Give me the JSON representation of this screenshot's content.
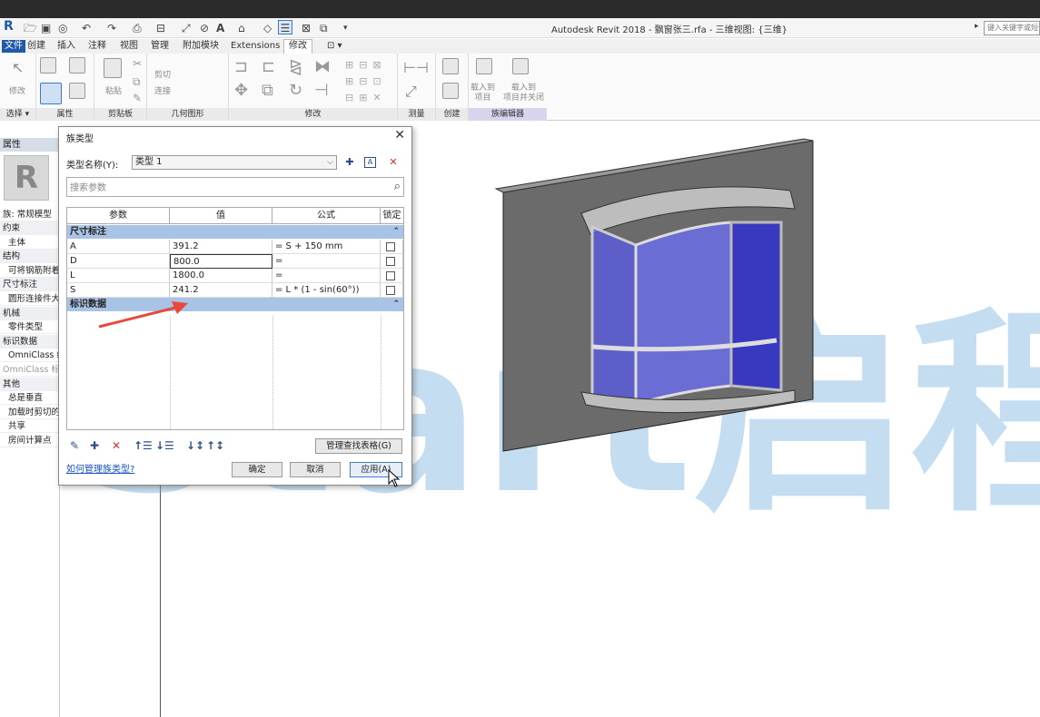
{
  "app": {
    "title": "Autodesk Revit 2018 -    飘窗张三.rfa - 三维视图: {三维}",
    "search_placeholder": "键入关键字或短语"
  },
  "tabs": [
    "文件",
    "创建",
    "插入",
    "注释",
    "视图",
    "管理",
    "附加模块",
    "Extensions",
    "修改",
    "⊡ ▾"
  ],
  "active_tab_index": 8,
  "ribbon": {
    "groups": [
      "选择 ▾",
      "属性",
      "剪贴板",
      "几何图形",
      "修改",
      "测量",
      "创建",
      "族编辑器"
    ],
    "labels": {
      "modify": "修改",
      "paste": "粘贴",
      "cut": "剪切",
      "join": "连接",
      "load_project": "载入到\n项目",
      "load_close": "载入到\n项目并关闭"
    }
  },
  "properties_panel": {
    "title": "属性",
    "family": "族: 常规模型",
    "rows": [
      {
        "text": "约束",
        "kind": "hdr"
      },
      {
        "text": "主体",
        "kind": "sub"
      },
      {
        "text": "结构",
        "kind": "hdr"
      },
      {
        "text": "可将钢筋附着",
        "kind": "sub"
      },
      {
        "text": "尺寸标注",
        "kind": "hdr"
      },
      {
        "text": "圆形连接件大",
        "kind": "sub"
      },
      {
        "text": "机械",
        "kind": "hdr"
      },
      {
        "text": "零件类型",
        "kind": "sub"
      },
      {
        "text": "标识数据",
        "kind": "hdr"
      },
      {
        "text": "OmniClass 编",
        "kind": "sub"
      },
      {
        "text": "OmniClass 标",
        "kind": "grey"
      },
      {
        "text": "其他",
        "kind": "hdr"
      },
      {
        "text": "总是垂直",
        "kind": "sub"
      },
      {
        "text": "加载时剪切的",
        "kind": "sub"
      },
      {
        "text": "共享",
        "kind": "sub"
      },
      {
        "text": "房间计算点",
        "kind": "sub"
      }
    ]
  },
  "dialog": {
    "title": "族类型",
    "close": "✕",
    "type_name_label": "类型名称(Y):",
    "type_name_value": "类型 1",
    "search_placeholder": "搜索参数",
    "columns": [
      "参数",
      "值",
      "公式",
      "锁定"
    ],
    "sections": [
      {
        "name": "尺寸标注",
        "rows": [
          {
            "param": "A",
            "value": "391.2",
            "formula": "= S + 150 mm",
            "locked": false
          },
          {
            "param": "D",
            "value": "800.0",
            "formula": "=",
            "locked": false
          },
          {
            "param": "L",
            "value": "1800.0",
            "formula": "=",
            "locked": false
          },
          {
            "param": "S",
            "value": "241.2",
            "formula": "= L * (1 - sin(60°))",
            "locked": false
          }
        ]
      },
      {
        "name": "标识数据",
        "rows": []
      }
    ],
    "lookup_button": "管理查找表格(G)",
    "help_link": "如何管理族类型?",
    "ok_button": "确定",
    "cancel_button": "取消",
    "apply_button": "应用(A)"
  },
  "watermark": {
    "text": "Start启程学"
  },
  "colors": {
    "accent": "#a9c3e6",
    "glass": "#5a5ae8",
    "wall": "#6e6e6e",
    "watermark_blue": "#7fb3dd",
    "watermark_orange": "#f2a46b",
    "arrow": "#e84a3a"
  }
}
